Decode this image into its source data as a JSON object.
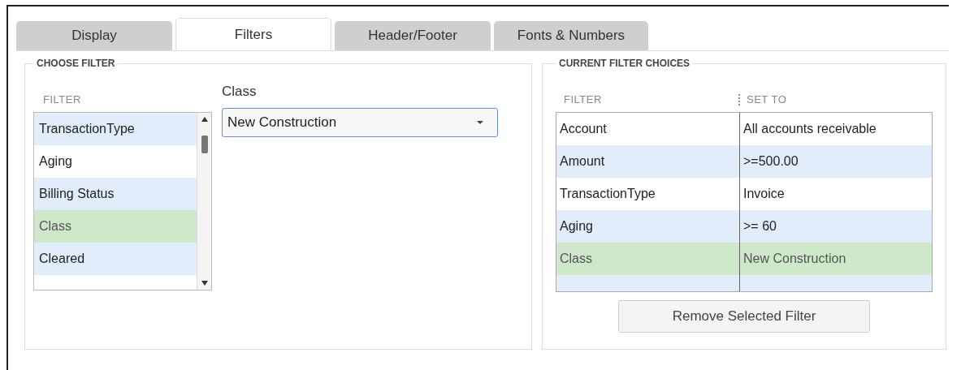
{
  "tabs": [
    {
      "label": "Display",
      "selected": false
    },
    {
      "label": "Filters",
      "selected": true
    },
    {
      "label": "Header/Footer",
      "selected": false
    },
    {
      "label": "Fonts & Numbers",
      "selected": false
    }
  ],
  "choose_filter": {
    "title": "CHOOSE FILTER",
    "list_header": "FILTER",
    "items": [
      {
        "label": "TransactionType",
        "selected": false
      },
      {
        "label": "Aging",
        "selected": false
      },
      {
        "label": "Billing Status",
        "selected": false
      },
      {
        "label": "Class",
        "selected": true
      },
      {
        "label": "Cleared",
        "selected": false
      }
    ],
    "field_label": "Class",
    "dropdown": {
      "value": "New Construction"
    }
  },
  "current_filter_choices": {
    "title": "CURRENT FILTER CHOICES",
    "columns": [
      "FILTER",
      "SET TO"
    ],
    "rows": [
      {
        "filter": "Account",
        "set_to": "All accounts receivable",
        "selected": false
      },
      {
        "filter": "Amount",
        "set_to": ">=500.00",
        "selected": false
      },
      {
        "filter": "TransactionType",
        "set_to": "Invoice",
        "selected": false
      },
      {
        "filter": "Aging",
        "set_to": ">= 60",
        "selected": false
      },
      {
        "filter": "Class",
        "set_to": "New Construction",
        "selected": true
      }
    ],
    "button": "Remove Selected Filter"
  }
}
